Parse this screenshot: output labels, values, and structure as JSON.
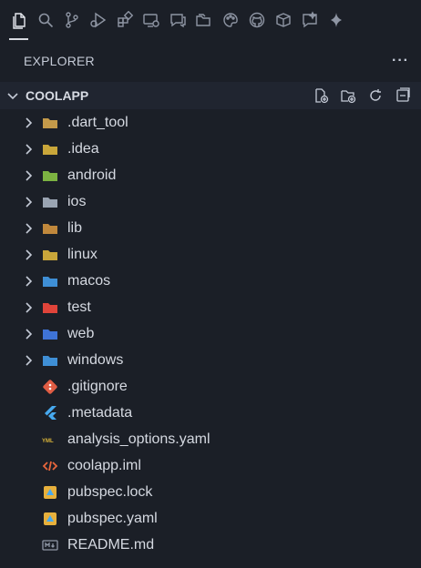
{
  "activity_bar": {
    "items": [
      {
        "icon": "explorer-files-icon"
      },
      {
        "icon": "search-icon"
      },
      {
        "icon": "source-control-icon"
      },
      {
        "icon": "run-debug-icon"
      },
      {
        "icon": "extensions-icon"
      },
      {
        "icon": "remote-explorer-icon"
      },
      {
        "icon": "chat-icon"
      },
      {
        "icon": "folders-icon"
      },
      {
        "icon": "palette-icon"
      },
      {
        "icon": "github-icon"
      },
      {
        "icon": "package-icon"
      },
      {
        "icon": "feedback-icon"
      },
      {
        "icon": "sparkle-icon"
      }
    ]
  },
  "explorer": {
    "title": "EXPLORER",
    "more_label": "···"
  },
  "project": {
    "name": "COOLAPP",
    "actions": [
      "new-file-icon",
      "new-folder-icon",
      "refresh-icon",
      "collapse-all-icon"
    ]
  },
  "tree": {
    "folders": [
      {
        "label": ".dart_tool",
        "icon": "folder-dart-icon",
        "color": "#c49a4a"
      },
      {
        "label": ".idea",
        "icon": "folder-idea-icon",
        "color": "#c9a63a"
      },
      {
        "label": "android",
        "icon": "folder-android-icon",
        "color": "#7cb342"
      },
      {
        "label": "ios",
        "icon": "folder-ios-icon",
        "color": "#9aa4b2"
      },
      {
        "label": "lib",
        "icon": "folder-lib-icon",
        "color": "#c0883c"
      },
      {
        "label": "linux",
        "icon": "folder-linux-icon",
        "color": "#c9a63a"
      },
      {
        "label": "macos",
        "icon": "folder-macos-icon",
        "color": "#3f8fd6"
      },
      {
        "label": "test",
        "icon": "folder-test-icon",
        "color": "#e0443a"
      },
      {
        "label": "web",
        "icon": "folder-web-icon",
        "color": "#3f73d6"
      },
      {
        "label": "windows",
        "icon": "folder-windows-icon",
        "color": "#3f8fd6"
      }
    ],
    "files": [
      {
        "label": ".gitignore",
        "icon": "git-icon",
        "color": "#e05d44"
      },
      {
        "label": ".metadata",
        "icon": "flutter-icon",
        "color": "#47a9ef"
      },
      {
        "label": "analysis_options.yaml",
        "icon": "yaml-icon",
        "color": "#d9b43a"
      },
      {
        "label": "coolapp.iml",
        "icon": "code-icon",
        "color": "#e8663c"
      },
      {
        "label": "pubspec.lock",
        "icon": "pubspec-icon",
        "color": "#e7b03c"
      },
      {
        "label": "pubspec.yaml",
        "icon": "pubspec-icon",
        "color": "#e7b03c"
      },
      {
        "label": "README.md",
        "icon": "markdown-icon",
        "color": "#8f97a6"
      }
    ]
  }
}
